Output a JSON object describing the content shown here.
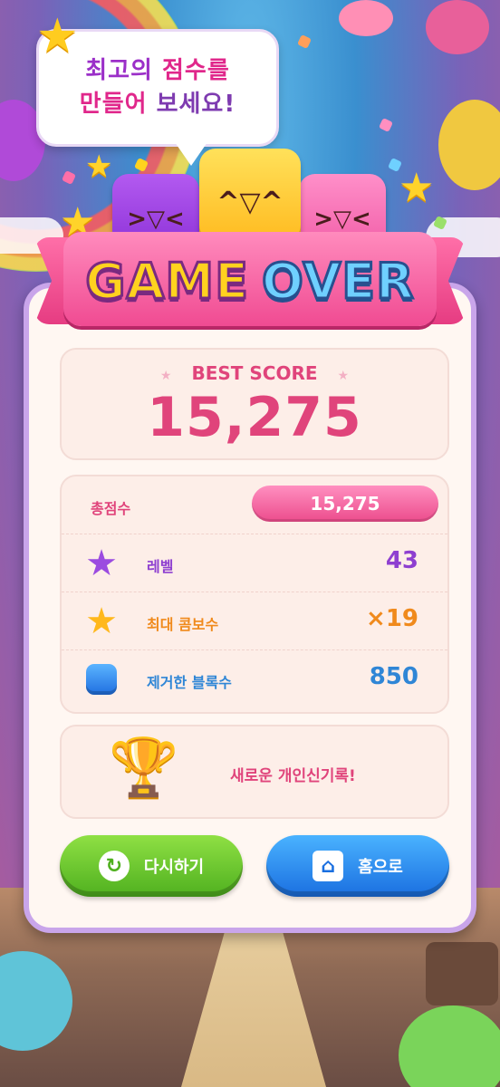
{
  "bubble": {
    "line1_a": "최고의 ",
    "line1_b": "점수를",
    "line2_a": "만들어 ",
    "line2_b": "보세요!"
  },
  "banner": {
    "word1": "GAME",
    "word2": "OVER"
  },
  "best_score": {
    "label": "BEST SCORE",
    "value": "15,275"
  },
  "stats": {
    "total": {
      "label": "총점수",
      "value": "15,275"
    },
    "level": {
      "label": "레벨",
      "value": "43",
      "icon": "purple-star-icon"
    },
    "combo": {
      "label": "최대 콤보수",
      "value": "×19",
      "icon": "gold-star-icon"
    },
    "blocks": {
      "label": "제거한 블록수",
      "value": "850",
      "icon": "blue-block-icon"
    }
  },
  "record": {
    "text": "새로운 개인신기록!",
    "icon": "trophy-icon"
  },
  "buttons": {
    "retry": "다시하기",
    "home": "홈으로"
  },
  "colors": {
    "accent_pink": "#e0447b",
    "purple": "#8e3fd0",
    "orange": "#f08a1c",
    "blue": "#2f86d6",
    "green_button": "#4fb01f",
    "blue_button": "#1a6fe0"
  }
}
